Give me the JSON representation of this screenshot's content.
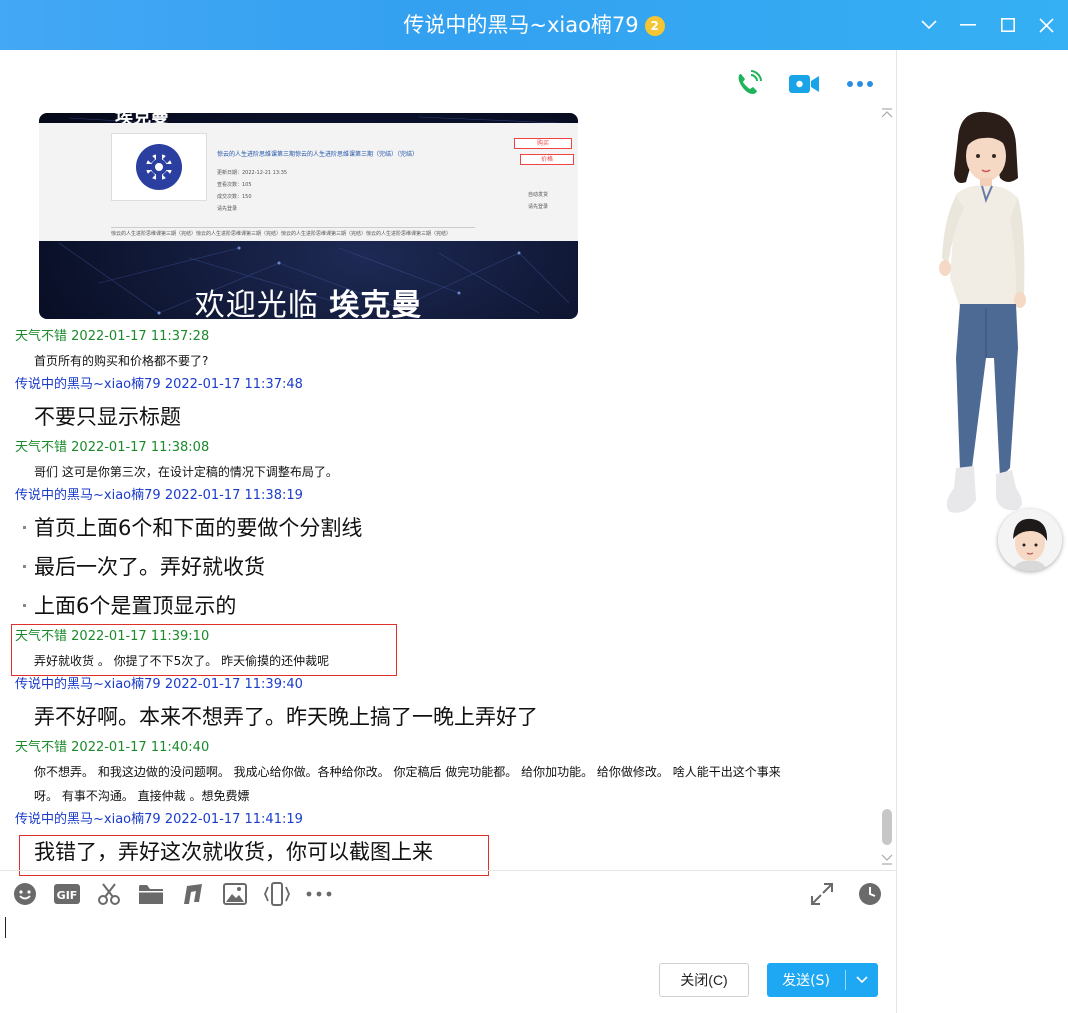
{
  "window": {
    "title": "传说中的黑马~xiao楠79",
    "vip_badge": "2"
  },
  "banner": {
    "top_text": "埃克曼",
    "product_title": "惊云的人生进阶思维课第三期惊云的人生进阶思维课第三期（完结）（完结）",
    "meta_lines": [
      "更新日期：2022-12-21 13:35",
      "查看次数：105",
      "成交次数：150",
      "请先登录"
    ],
    "buy_label": "购买",
    "price_label": "价格",
    "right_lines": [
      "自动发货",
      "请先登录"
    ],
    "footer_text": "惊云的人生进阶思维课第三期（完结）惊云的人生进阶思维课第三期（完结）惊云的人生进阶思维课第三期（完结）惊云的人生进阶思维课第三期（完结）",
    "welcome_prefix": "欢迎光临",
    "welcome_brand": "埃克曼"
  },
  "messages": [
    {
      "sender": "天气不错",
      "time": "2022-01-17 11:37:28",
      "lines": [
        "首页所有的购买和价格都不要了?"
      ]
    },
    {
      "sender": "传说中的黑马~xiao楠79",
      "time": "2022-01-17 11:37:48",
      "lines": [
        "不要只显示标题"
      ]
    },
    {
      "sender": "天气不错",
      "time": "2022-01-17 11:38:08",
      "lines": [
        "哥们 这可是你第三次，在设计定稿的情况下调整布局了。"
      ]
    },
    {
      "sender": "传说中的黑马~xiao楠79",
      "time": "2022-01-17 11:38:19",
      "lines": [
        "首页上面6个和下面的要做个分割线",
        "最后一次了。弄好就收货",
        "上面6个是置顶显示的"
      ]
    },
    {
      "sender": "天气不错",
      "time": "2022-01-17 11:39:10",
      "lines": [
        "弄好就收货 。 你提了不下5次了。  昨天偷摸的还仲裁呢"
      ]
    },
    {
      "sender": "传说中的黑马~xiao楠79",
      "time": "2022-01-17 11:39:40",
      "lines": [
        "弄不好啊。本来不想弄了。昨天晚上搞了一晚上弄好了"
      ]
    },
    {
      "sender": "天气不错",
      "time": "2022-01-17 11:40:40",
      "lines": [
        "你不想弄。 和我这边做的没问题啊。  我成心给你做。各种给你改。  你定稿后 做完功能都。 给你加功能。  给你做修改。 啥人能干出这个事来",
        "呀。  有事不沟通。 直接仲裁 。想免费嫖"
      ]
    },
    {
      "sender": "传说中的黑马~xiao楠79",
      "time": "2022-01-17 11:41:19",
      "lines": [
        "我错了，弄好这次就收货，你可以截图上来"
      ]
    }
  ],
  "buttons": {
    "close": "关闭(C)",
    "send": "发送(S)"
  },
  "icons": {
    "call": "phone-call-icon",
    "video": "video-call-icon",
    "more": "more-icon"
  },
  "colors": {
    "titlebar": "#3ba4f3",
    "send_button": "#1ea7f2",
    "self_name": "#1b8a2a",
    "other_name": "#1a3ccc",
    "highlight_box": "#e0302a"
  }
}
